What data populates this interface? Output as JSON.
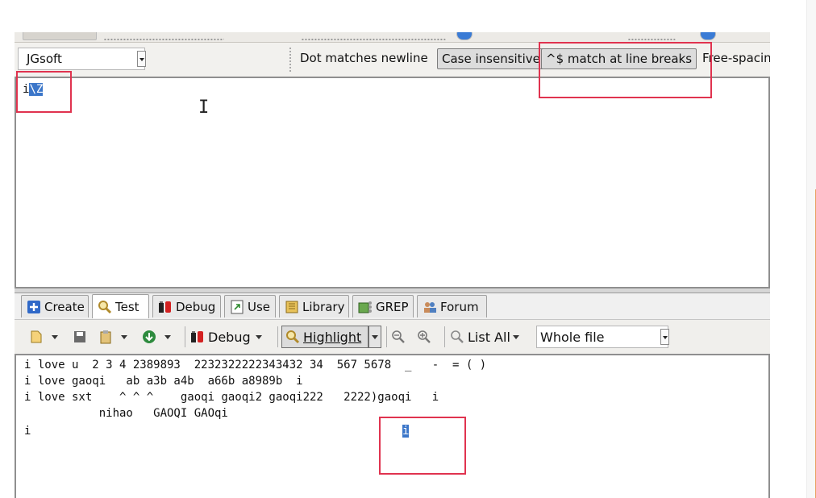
{
  "options": {
    "flavor": "JGsoft",
    "dot_matches_newline": "Dot matches newline",
    "case_insensitive": "Case insensitive",
    "match_at_line_breaks": "^$ match at line breaks",
    "free_spacing": "Free-spacin"
  },
  "regex": {
    "text_plain": "i",
    "text_selected": "\\Z"
  },
  "tabs": [
    {
      "label": "Create"
    },
    {
      "label": "Test"
    },
    {
      "label": "Debug"
    },
    {
      "label": "Use"
    },
    {
      "label": "Library"
    },
    {
      "label": "GREP"
    },
    {
      "label": "Forum"
    }
  ],
  "results_toolbar": {
    "debug_label": "Debug",
    "highlight_label": "Highlight",
    "list_all_label": "List All",
    "scope_value": "Whole file"
  },
  "test_text": {
    "lines": [
      "i love u  2 3 4 2389893  2232322222343432 34  567 5678  _   -  = ( )",
      "i love gaoqi   ab a3b a4b  a66b a8989b  i",
      "i love sxt    ^ ^ ^    gaoqi gaoqi2 gaoqi222   2222)gaoqi   i",
      "           nihao   GAOQI GAOqi",
      "i"
    ],
    "match_text": "i"
  },
  "colors": {
    "selection": "#3b76c9",
    "annotation_red": "#e0334f"
  }
}
